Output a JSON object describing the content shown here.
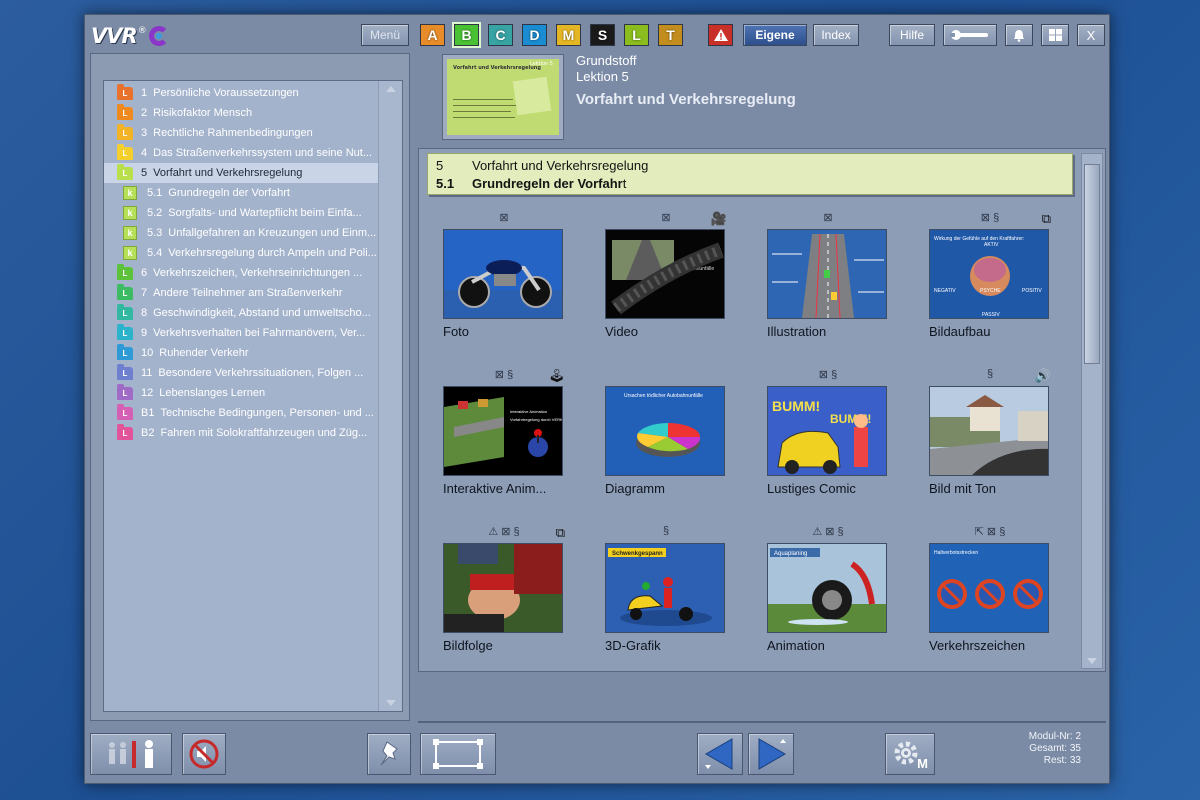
{
  "logo": {
    "text": "VVR",
    "reg": "®"
  },
  "topbar": {
    "menu_label": "Menü",
    "categories": [
      {
        "label": "A",
        "color": "#e88c2a"
      },
      {
        "label": "B",
        "color": "#49c233"
      },
      {
        "label": "C",
        "color": "#38a3a3"
      },
      {
        "label": "D",
        "color": "#1a8cd1"
      },
      {
        "label": "M",
        "color": "#e5b623"
      },
      {
        "label": "S",
        "color": "#1a1a1a"
      },
      {
        "label": "L",
        "color": "#8abd1d"
      },
      {
        "label": "T",
        "color": "#c28d1d"
      }
    ],
    "warning_icon": "warning-icon",
    "eigene_label": "Eigene",
    "index_label": "Index",
    "hilfe_label": "Hilfe",
    "wrench_icon": "wrench-icon",
    "bell_icon": "bell-icon",
    "windows_icon": "windows-icon",
    "close_label": "X"
  },
  "tree": {
    "items": [
      {
        "num": "1",
        "label": "Persönliche Voraussetzungen",
        "color": "#e8722c",
        "kind": "folder"
      },
      {
        "num": "2",
        "label": "Risikofaktor Mensch",
        "color": "#f08a1e",
        "kind": "folder"
      },
      {
        "num": "3",
        "label": "Rechtliche Rahmenbedingungen",
        "color": "#f3b327",
        "kind": "folder"
      },
      {
        "num": "4",
        "label": "Das Straßenverkehrssystem und seine Nut...",
        "color": "#f5d02c",
        "kind": "folder"
      },
      {
        "num": "5",
        "label": "Vorfahrt und Verkehrsregelung",
        "color": "#b9e04c",
        "kind": "folder",
        "selected": true
      },
      {
        "num": "5.1",
        "label": "Grundregeln der Vorfahrt",
        "kind": "doc"
      },
      {
        "num": "5.2",
        "label": "Sorgfalts- und Wartepflicht beim Einfa...",
        "kind": "doc"
      },
      {
        "num": "5.3",
        "label": "Unfallgefahren  an Kreuzungen und Einm...",
        "kind": "doc"
      },
      {
        "num": "5.4",
        "label": "Verkehrsregelung durch Ampeln und Poli...",
        "kind": "doc"
      },
      {
        "num": "6",
        "label": "Verkehrszeichen, Verkehrseinrichtungen ...",
        "color": "#5cc23a",
        "kind": "folder"
      },
      {
        "num": "7",
        "label": "Andere Teilnehmer am Straßenverkehr",
        "color": "#3dbb62",
        "kind": "folder"
      },
      {
        "num": "8",
        "label": "Geschwindigkeit, Abstand und umweltscho...",
        "color": "#32b8a0",
        "kind": "folder"
      },
      {
        "num": "9",
        "label": "Verkehrsverhalten bei Fahrmanövern, Ver...",
        "color": "#2cb3cc",
        "kind": "folder"
      },
      {
        "num": "10",
        "label": "Ruhender Verkehr",
        "color": "#2d9ad6",
        "kind": "folder"
      },
      {
        "num": "11",
        "label": "Besondere Verkehrssituationen, Folgen ...",
        "color": "#6f7fcf",
        "kind": "folder"
      },
      {
        "num": "12",
        "label": "Lebenslanges Lernen",
        "color": "#a06bc6",
        "kind": "folder"
      },
      {
        "num": "B1",
        "label": "Technische Bedingungen, Personen- und ...",
        "color": "#d45fb4",
        "kind": "folder"
      },
      {
        "num": "B2",
        "label": "Fahren mit Solokraftfahrzeugen und Züg...",
        "color": "#e2549a",
        "kind": "folder"
      }
    ]
  },
  "thumb": {
    "title": "Vorfahrt und Verkehrsregelung",
    "label": "Lektion 5"
  },
  "lesson": {
    "category": "Grundstoff",
    "lesson": "Lektion 5",
    "title": "Vorfahrt und Verkehrsregelung"
  },
  "chapter": {
    "num": "5",
    "title": "Vorfahrt und Verkehrsregelung",
    "sub_num": "5.1",
    "sub_title": "Grundregeln der Vorfahr",
    "sub_title_tail": "t"
  },
  "media": [
    {
      "caption": "Foto",
      "icons": "⊠",
      "extra": ""
    },
    {
      "caption": "Video",
      "icons": "⊠",
      "extra": "🎥"
    },
    {
      "caption": "Illustration",
      "icons": "⊠",
      "extra": ""
    },
    {
      "caption": "Bildaufbau",
      "icons": "⊠ §",
      "extra": "⧉"
    },
    {
      "caption": "Interaktive Anim...",
      "icons": "⊠ §",
      "extra": "🕹"
    },
    {
      "caption": "Diagramm",
      "icons": "",
      "extra": ""
    },
    {
      "caption": "Lustiges Comic",
      "icons": "⊠ §",
      "extra": ""
    },
    {
      "caption": "Bild mit Ton",
      "icons": "§",
      "extra": "🔊"
    },
    {
      "caption": "Bildfolge",
      "icons": "⚠ ⊠ §",
      "extra": "⧉"
    },
    {
      "caption": "3D-Grafik",
      "icons": "§",
      "extra": ""
    },
    {
      "caption": "Animation",
      "icons": "⚠ ⊠ §",
      "extra": ""
    },
    {
      "caption": "Verkehrszeichen",
      "icons": "⇱  ⊠ §",
      "extra": ""
    }
  ],
  "pics": {
    "video_text": "Autobahnunfälle",
    "diagram_title": "Ursachen tödlicher Autobahnunfälle",
    "interactive_text": "Interaktive Animation",
    "interactive_text2": "Vorfahrtregelung durch VERKEHRSZEICHEN !",
    "bildaufbau_title": "Wirkung der Gefühle auf den Kraftfahrer:",
    "bildaufbau_labels": [
      "AKTIV",
      "NEGATIV",
      "PSYCHE",
      "POSITIV",
      "PASSIV"
    ],
    "comic_text": "BUMM!",
    "grafik_title": "Schwenkgespann",
    "animation_title": "Aquaplaning",
    "zeichen_title": "Haltverbotsstrecken"
  },
  "module": {
    "modul_label": "Modul-Nr:",
    "modul_val": "2",
    "gesamt_label": "Gesamt:",
    "gesamt_val": "35",
    "rest_label": "Rest:",
    "rest_val": "33"
  },
  "bottom_icons": {
    "persons": "persons-icon",
    "mute": "sound-off-icon",
    "pin": "pushpin-icon",
    "frame": "fullscreen-icon",
    "prev": "previous-arrow-icon",
    "next": "next-arrow-icon",
    "settings": "gear-icon",
    "settings_label": "M"
  }
}
